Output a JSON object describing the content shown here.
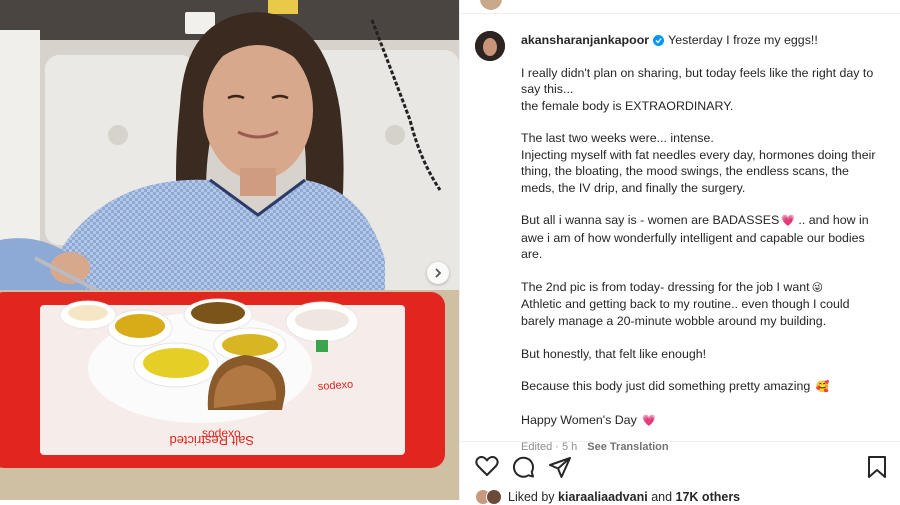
{
  "post": {
    "username": "akansharanjankapoor",
    "verified": true,
    "caption_first_line": "Yesterday I froze my eggs!!",
    "paragraphs": [
      [
        "I really didn't plan on sharing, but today feels like the right day to",
        "say this...",
        "the female body is EXTRAORDINARY."
      ],
      [
        "The last two weeks were... intense.",
        "Injecting myself with fat needles every day, hormones doing their",
        "thing, the bloating, the mood swings, the endless scans, the",
        "meds, the IV drip, and finally the surgery."
      ],
      [
        "But all i wanna say is - women are BADASSES",
        ".. and how in",
        "awe i am of how wonderfully intelligent and capable our bodies",
        "are."
      ],
      [
        "The 2nd pic is from today- dressing for the job I want",
        "Athletic and getting back to my routine.. even though I could",
        "barely manage a 20-minute wobble around my building."
      ],
      [
        "But honestly, that felt like enough!"
      ],
      [
        "Because this body just did something pretty amazing"
      ],
      [
        "Happy Women's Day"
      ]
    ],
    "emojis": {
      "badasses": "💗",
      "job": "😜",
      "amazing": "🥰",
      "womens_day": "💗"
    },
    "edited_label": "Edited",
    "dot": "·",
    "time_ago": "5 h",
    "see_translation": "See Translation"
  },
  "photo": {
    "tray_brand": "sodexo",
    "tray_warning": "Salt Restricted"
  },
  "actions": {
    "icons": [
      "heart-icon",
      "comment-icon",
      "share-icon",
      "save-icon"
    ]
  },
  "likes": {
    "prefix": "Liked by",
    "user": "kiaraaliaadvani",
    "middle": "and",
    "others": "17K others"
  },
  "colors": {
    "tray_red": "#e0261f",
    "gown_blue": "#8da9d6",
    "link_blue": "#0095f6",
    "meta_gray": "#8e8e8e"
  }
}
